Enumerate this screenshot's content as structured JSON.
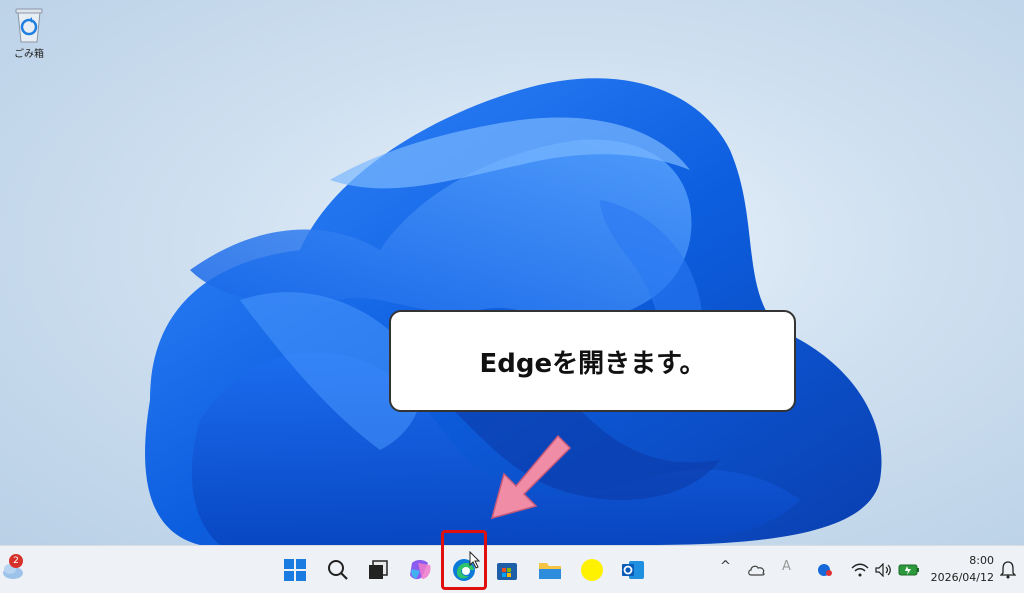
{
  "desktop": {
    "recycle_bin_label": "ごみ箱"
  },
  "callout": {
    "text": "Edgeを開きます。"
  },
  "taskbar": {
    "weather_badge": "2",
    "apps": [
      {
        "name": "start",
        "icon": "windows-icon"
      },
      {
        "name": "search",
        "icon": "search-icon"
      },
      {
        "name": "task-view",
        "icon": "task-view-icon"
      },
      {
        "name": "copilot",
        "icon": "copilot-icon"
      },
      {
        "name": "edge",
        "icon": "edge-icon"
      },
      {
        "name": "store",
        "icon": "store-icon"
      },
      {
        "name": "file-explorer",
        "icon": "folder-icon"
      },
      {
        "name": "yellow-app",
        "icon": "yellow-circle-icon"
      },
      {
        "name": "outlook",
        "icon": "outlook-icon"
      }
    ],
    "tray": {
      "chevron": "^",
      "ime": "A"
    },
    "clock": {
      "time": "8:00",
      "date": "2026/04/12"
    }
  },
  "colors": {
    "highlight": "#e01010",
    "arrow": "#f08ca6",
    "accent": "#0a64d6"
  }
}
